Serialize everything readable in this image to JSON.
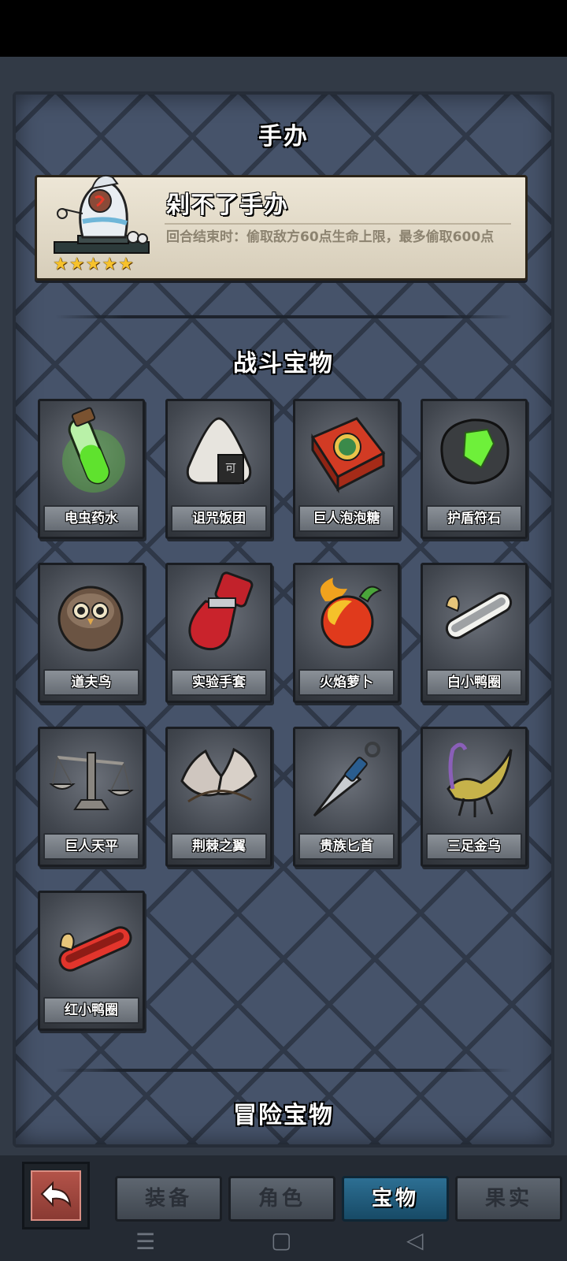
{
  "header": {
    "title": "手办"
  },
  "figure": {
    "name": "剁不了手办",
    "description": "回合结束时：偷取敌方60点生命上限，最多偷取600点",
    "stars": 5
  },
  "battle_section": {
    "title": "战斗宝物"
  },
  "items": [
    {
      "label": "电虫药水",
      "icon": "potion-icon"
    },
    {
      "label": "诅咒饭团",
      "icon": "rice-ball-icon"
    },
    {
      "label": "巨人泡泡糖",
      "icon": "gum-box-icon"
    },
    {
      "label": "护盾符石",
      "icon": "rune-stone-icon"
    },
    {
      "label": "道夫鸟",
      "icon": "owl-icon"
    },
    {
      "label": "实验手套",
      "icon": "glove-icon"
    },
    {
      "label": "火焰萝卜",
      "icon": "fire-radish-icon"
    },
    {
      "label": "白小鸭圈",
      "icon": "white-ring-icon"
    },
    {
      "label": "巨人天平",
      "icon": "scale-icon"
    },
    {
      "label": "荆棘之翼",
      "icon": "thorn-wings-icon"
    },
    {
      "label": "贵族匕首",
      "icon": "dagger-icon"
    },
    {
      "label": "三足金乌",
      "icon": "golden-bird-icon"
    },
    {
      "label": "红小鸭圈",
      "icon": "red-ring-icon"
    }
  ],
  "adventure_section": {
    "title": "冒险宝物"
  },
  "nav": {
    "back_icon": "back-arrow-icon",
    "tabs": [
      {
        "label": "装备",
        "active": false
      },
      {
        "label": "角色",
        "active": false
      },
      {
        "label": "宝物",
        "active": true
      },
      {
        "label": "果实",
        "active": false
      }
    ]
  },
  "system_bar": {
    "icons": [
      "menu-icon",
      "home-icon",
      "back-icon"
    ]
  }
}
